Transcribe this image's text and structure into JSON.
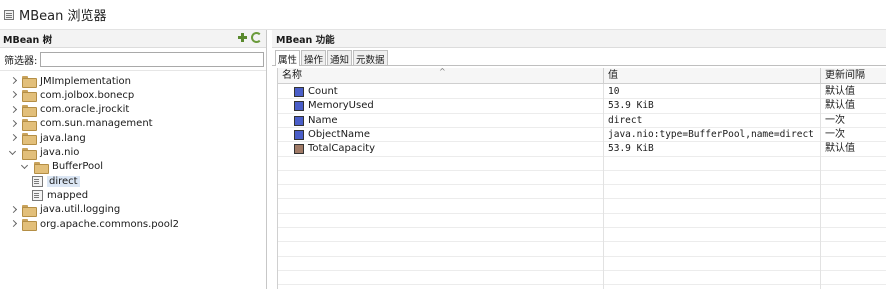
{
  "window": {
    "title": "MBean 浏览器"
  },
  "tree_panel": {
    "title": "MBean 树",
    "filter_label": "筛选器:",
    "filter_value": "",
    "items": [
      {
        "label": "JMImplementation",
        "expanded": false,
        "indent": 0,
        "kind": "folder"
      },
      {
        "label": "com.jolbox.bonecp",
        "expanded": false,
        "indent": 0,
        "kind": "folder"
      },
      {
        "label": "com.oracle.jrockit",
        "expanded": false,
        "indent": 0,
        "kind": "folder"
      },
      {
        "label": "com.sun.management",
        "expanded": false,
        "indent": 0,
        "kind": "folder"
      },
      {
        "label": "java.lang",
        "expanded": false,
        "indent": 0,
        "kind": "folder"
      },
      {
        "label": "java.nio",
        "expanded": true,
        "indent": 0,
        "kind": "folder"
      },
      {
        "label": "BufferPool",
        "expanded": true,
        "indent": 1,
        "kind": "folder"
      },
      {
        "label": "direct",
        "indent": 2,
        "kind": "bean",
        "selected": true
      },
      {
        "label": "mapped",
        "indent": 2,
        "kind": "bean"
      },
      {
        "label": "java.util.logging",
        "expanded": false,
        "indent": 0,
        "kind": "folder"
      },
      {
        "label": "org.apache.commons.pool2",
        "expanded": false,
        "indent": 0,
        "kind": "folder"
      }
    ]
  },
  "features_panel": {
    "title": "MBean 功能",
    "tabs": [
      {
        "label": "属性",
        "active": true
      },
      {
        "label": "操作",
        "active": false
      },
      {
        "label": "通知",
        "active": false
      },
      {
        "label": "元数据",
        "active": false
      }
    ],
    "columns": [
      "名称",
      "值",
      "更新间隔"
    ],
    "rows": [
      {
        "name": "Count",
        "value": "10",
        "interval": "默认值",
        "icon_color": "#4a5ec8"
      },
      {
        "name": "MemoryUsed",
        "value": "53.9 KiB",
        "interval": "默认值",
        "icon_color": "#4a5ec8"
      },
      {
        "name": "Name",
        "value": "direct",
        "interval": "一次",
        "icon_color": "#4a5ec8"
      },
      {
        "name": "ObjectName",
        "value": "java.nio:type=BufferPool,name=direct",
        "interval": "一次",
        "icon_color": "#4a5ec8"
      },
      {
        "name": "TotalCapacity",
        "value": "53.9 KiB",
        "interval": "默认值",
        "icon_color": "#a07a66"
      }
    ]
  }
}
